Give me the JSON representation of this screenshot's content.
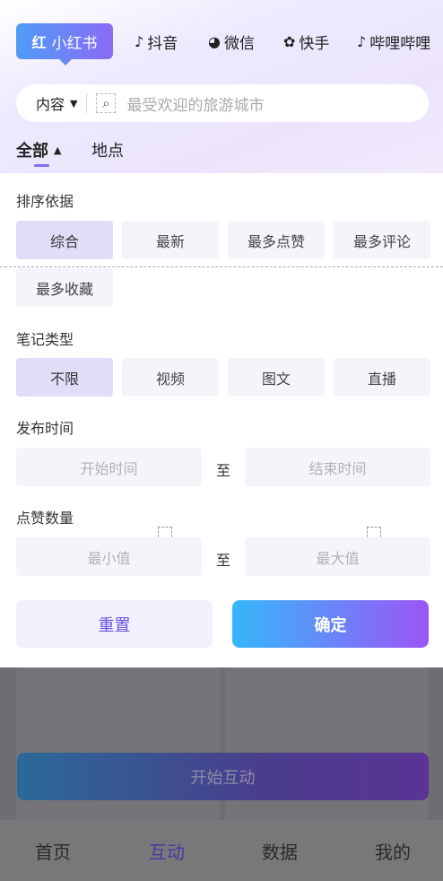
{
  "platforms": {
    "active": {
      "logo": "红",
      "label": "小红书"
    },
    "items": [
      {
        "icon": "douyin-icon",
        "glyph": "♪",
        "label": "抖音"
      },
      {
        "icon": "wechat-icon",
        "glyph": "◕",
        "label": "微信"
      },
      {
        "icon": "kuaishou-icon",
        "glyph": "✿",
        "label": "快手"
      },
      {
        "icon": "bilibili-icon",
        "glyph": "♪",
        "label": "哔哩哔哩"
      }
    ]
  },
  "search": {
    "scope_label": "内容",
    "placeholder": "最受欢迎的旅游城市"
  },
  "tabs": [
    {
      "label": "全部",
      "active": true
    },
    {
      "label": "地点",
      "active": false
    }
  ],
  "filters": {
    "sort": {
      "title": "排序依据",
      "options": [
        "综合",
        "最新",
        "最多点赞",
        "最多评论",
        "最多收藏"
      ],
      "selected": "综合"
    },
    "note_type": {
      "title": "笔记类型",
      "options": [
        "不限",
        "视频",
        "图文",
        "直播"
      ],
      "selected": "不限"
    },
    "publish_time": {
      "title": "发布时间",
      "start_placeholder": "开始时间",
      "to": "至",
      "end_placeholder": "结束时间"
    },
    "likes": {
      "title": "点赞数量",
      "min_placeholder": "最小值",
      "to": "至",
      "max_placeholder": "最大值"
    }
  },
  "actions": {
    "reset": "重置",
    "confirm": "确定"
  },
  "background": {
    "start_button": "开始互动"
  },
  "bottom_nav": {
    "items": [
      {
        "label": "首页",
        "active": false
      },
      {
        "label": "互动",
        "active": true
      },
      {
        "label": "数据",
        "active": false
      },
      {
        "label": "我的",
        "active": false
      }
    ]
  },
  "colors": {
    "accent": "#7f6ef2",
    "chip_selected": "#e2dcf9",
    "chip_default": "#f4f5fb",
    "confirm_gradient_start": "#36b7fb",
    "confirm_gradient_end": "#9a56f5",
    "overlay": "#6e6e72"
  }
}
